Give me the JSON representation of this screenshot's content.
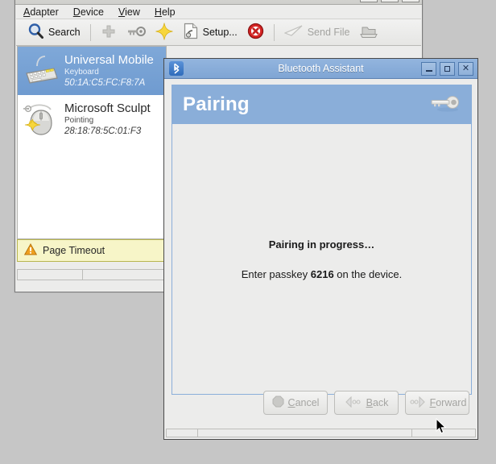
{
  "main_window": {
    "menubar": [
      {
        "name": "adapter",
        "mnemonic": "A",
        "rest": "dapter"
      },
      {
        "name": "device",
        "mnemonic": "D",
        "rest": "evice"
      },
      {
        "name": "view",
        "mnemonic": "V",
        "rest": "iew"
      },
      {
        "name": "help",
        "mnemonic": "H",
        "rest": "elp"
      }
    ],
    "toolbar": {
      "search_label": "Search",
      "setup_label": "Setup...",
      "send_file_label": "Send File",
      "icons": {
        "search": "magnifier-icon",
        "add": "plus-icon",
        "key": "key-icon",
        "trust": "star-icon",
        "setup": "setup-document-icon",
        "remove": "remove-x-icon",
        "send_file": "paper-plane-icon",
        "browse": "folder-icon"
      }
    },
    "devices": [
      {
        "name": "Universal Mobile",
        "type": "Keyboard",
        "mac": "50:1A:C5:FC:F8:7A",
        "icon": "keyboard-icon",
        "selected": true,
        "trusted": false
      },
      {
        "name": "Microsoft Sculpt",
        "type": "Pointing",
        "mac": "28:18:78:5C:01:F3",
        "icon": "mouse-icon",
        "selected": false,
        "trusted": true
      }
    ],
    "status": {
      "text": "Page Timeout",
      "icon": "warning-triangle-icon",
      "background": "#f7f5c8",
      "border": "#b8b650"
    }
  },
  "dialog": {
    "title": "Bluetooth Assistant",
    "titlebar_icon": "bluetooth-icon",
    "header_title": "Pairing",
    "header_icon": "key-icon",
    "header_color": "#8aaed9",
    "window_buttons": {
      "minimize": "minimize-icon",
      "maximize": "maximize-icon",
      "close": "✕"
    },
    "content": {
      "status": "Pairing in progress…",
      "instruction_prefix": "Enter passkey ",
      "passkey": "6216",
      "instruction_suffix": " on the device."
    },
    "actions": [
      {
        "name": "cancel",
        "mnemonic": "C",
        "before": "",
        "rest": "ancel",
        "icon": "stop-icon",
        "disabled": true
      },
      {
        "name": "back",
        "mnemonic": "B",
        "before": "",
        "rest": "ack",
        "icon": "arrow-left-icon",
        "disabled": true
      },
      {
        "name": "forward",
        "mnemonic": "F",
        "before": "",
        "rest": "orward",
        "icon": "arrow-right-icon",
        "disabled": true
      }
    ]
  },
  "colors": {
    "selection": "#7fa8d8",
    "desktop": "#c6c6c6",
    "chrome": "#ececeb"
  }
}
